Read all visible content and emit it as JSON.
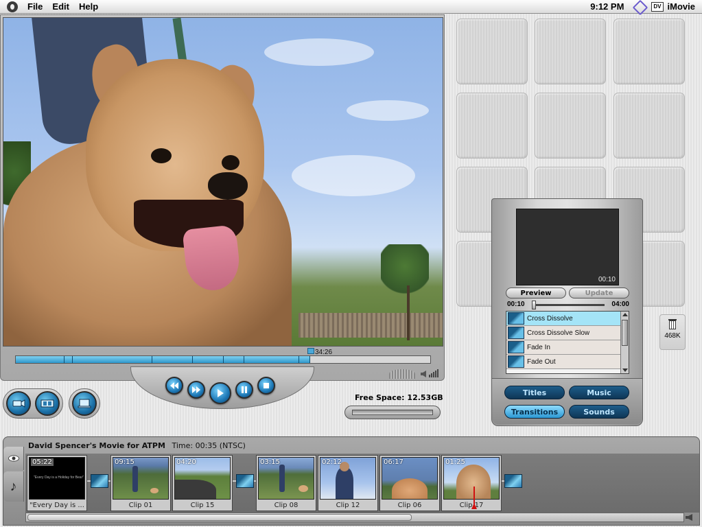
{
  "menubar": {
    "menus": [
      "File",
      "Edit",
      "Help"
    ],
    "clock": "9:12 PM",
    "dv_badge": "DV",
    "app_name": "iMovie"
  },
  "monitor": {
    "playhead_time": "34:26",
    "playhead_fraction": 0.71
  },
  "free_space": {
    "label": "Free Space: 12.53GB"
  },
  "trash": {
    "size": "468K"
  },
  "effects": {
    "preview_time": "00:10",
    "preview_button": "Preview",
    "update_button": "Update",
    "speed_min": "00:10",
    "speed_max": "04:00",
    "items": [
      {
        "label": "Cross Dissolve",
        "selected": true
      },
      {
        "label": "Cross Dissolve Slow",
        "selected": false
      },
      {
        "label": "Fade In",
        "selected": false
      },
      {
        "label": "Fade Out",
        "selected": false
      }
    ],
    "tabs": [
      {
        "label": "Titles",
        "active": false
      },
      {
        "label": "Music",
        "active": false
      },
      {
        "label": "Transitions",
        "active": true
      },
      {
        "label": "Sounds",
        "active": false
      }
    ]
  },
  "timeline": {
    "movie_title": "David Spencer's Movie for ATPM",
    "time_info": "Time: 00:35 (NTSC)",
    "clips": [
      {
        "duration": "05:22",
        "label": "\"Every Day is ...",
        "title_text": "\"Every Day is a Holiday for Bear\""
      },
      {
        "duration": "09:15",
        "label": "Clip 01"
      },
      {
        "duration": "04:20",
        "label": "Clip 15"
      },
      {
        "duration": "03:15",
        "label": "Clip 08"
      },
      {
        "duration": "02:12",
        "label": "Clip 12"
      },
      {
        "duration": "06:17",
        "label": "Clip 06"
      },
      {
        "duration": "01:25",
        "label": "Clip 17"
      }
    ]
  },
  "colors": {
    "accent_blue": "#2f98cc",
    "selected_row": "#a4e4f7",
    "playhead": "#d01010"
  }
}
